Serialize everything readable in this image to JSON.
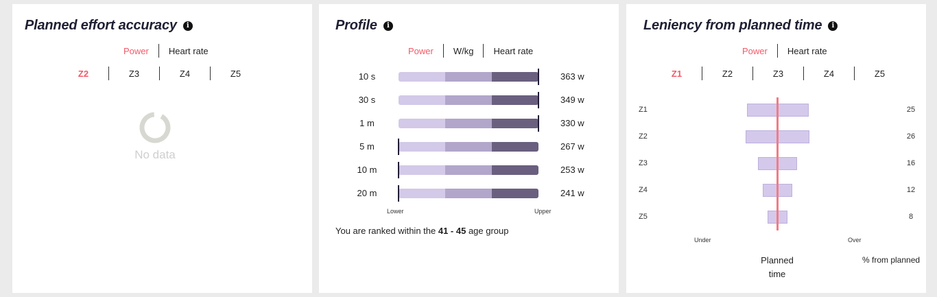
{
  "card1": {
    "title": "Planned effort accuracy",
    "info_icon": "info-icon",
    "metric_tabs": [
      "Power",
      "Heart rate"
    ],
    "active_metric": "Power",
    "zones": [
      "Z2",
      "Z3",
      "Z4",
      "Z5"
    ],
    "active_zone": "Z2",
    "empty_text": "No data"
  },
  "card2": {
    "title": "Profile",
    "info_icon": "info-icon",
    "metric_tabs": [
      "Power",
      "W/kg",
      "Heart rate"
    ],
    "active_metric": "Power",
    "rows": [
      {
        "duration": "10 s",
        "value": "363 w",
        "marker_fraction": 1.0
      },
      {
        "duration": "30 s",
        "value": "349 w",
        "marker_fraction": 1.0
      },
      {
        "duration": "1 m",
        "value": "330 w",
        "marker_fraction": 1.0
      },
      {
        "duration": "5 m",
        "value": "267 w",
        "marker_fraction": 0.0
      },
      {
        "duration": "10 m",
        "value": "253 w",
        "marker_fraction": 0.0
      },
      {
        "duration": "20 m",
        "value": "241 w",
        "marker_fraction": 0.0
      }
    ],
    "axis_lower": "Lower",
    "axis_upper": "Upper",
    "rank_prefix": "You are ranked within the ",
    "rank_group": "41 - 45",
    "rank_suffix": " age group"
  },
  "card3": {
    "title": "Leniency from planned time",
    "info_icon": "info-icon",
    "metric_tabs": [
      "Power",
      "Heart rate"
    ],
    "active_metric": "Power",
    "zones": [
      "Z1",
      "Z2",
      "Z3",
      "Z4",
      "Z5"
    ],
    "active_zone": "Z1",
    "rows": [
      {
        "zone": "Z1",
        "value": "25",
        "leniency": 25
      },
      {
        "zone": "Z2",
        "value": "26",
        "leniency": 26
      },
      {
        "zone": "Z3",
        "value": "16",
        "leniency": 16
      },
      {
        "zone": "Z4",
        "value": "12",
        "leniency": 12
      },
      {
        "zone": "Z5",
        "value": "8",
        "leniency": 8
      }
    ],
    "axis_under": "Under",
    "axis_over": "Over",
    "planned_line1": "Planned",
    "planned_line2": "time",
    "pct_label": "% from planned"
  },
  "colors": {
    "accent": "#f25a68",
    "bar_light": "#d3c9e8",
    "bar_mid": "#b2a6cb",
    "bar_dark": "#6a5f7f",
    "planned_line": "#f27b84"
  }
}
